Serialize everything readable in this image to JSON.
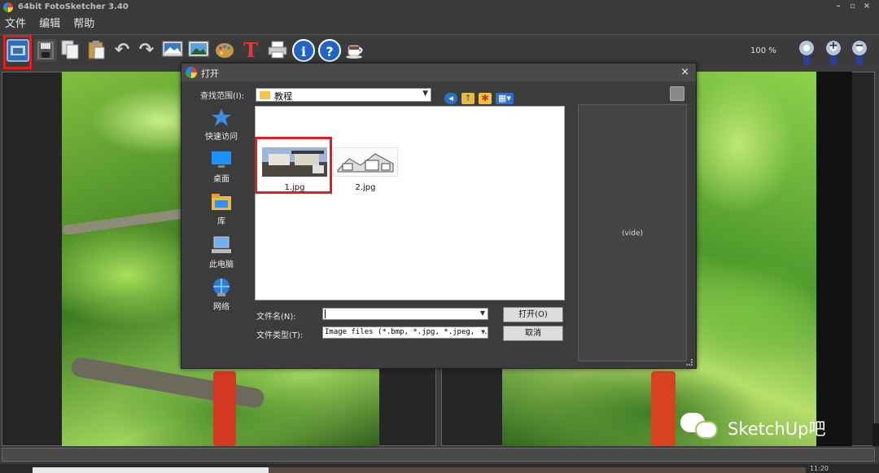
{
  "window": {
    "title": "64bit FotoSketcher 3.40",
    "controls": [
      "–",
      "▫",
      "×"
    ]
  },
  "menu": [
    "文件",
    "编辑",
    "帮助"
  ],
  "toolbar": {
    "zoom_level": "100 %",
    "icons": [
      "open-image-icon",
      "save-icon",
      "copy-icon",
      "paste-icon",
      "undo-icon",
      "redo-icon",
      "image-settings-icon",
      "landscape-icon",
      "palette-icon",
      "text-tool-icon",
      "print-icon",
      "info-icon",
      "help-icon",
      "coffee-icon"
    ],
    "zoom_buttons": [
      "zoom-fit-icon",
      "zoom-in-icon",
      "zoom-out-icon"
    ]
  },
  "dialog": {
    "title": "打开",
    "close": "×",
    "look_in_label": "查找范围(I):",
    "look_in_value": "教程",
    "places": [
      {
        "label": "快速访问",
        "icon": "star-icon"
      },
      {
        "label": "桌面",
        "icon": "desktop-icon"
      },
      {
        "label": "库",
        "icon": "library-icon"
      },
      {
        "label": "此电脑",
        "icon": "computer-icon"
      },
      {
        "label": "网络",
        "icon": "network-icon"
      }
    ],
    "files": [
      {
        "name": "1.jpg"
      },
      {
        "name": "2.jpg"
      }
    ],
    "preview_text": "(vide)",
    "filename_label": "文件名(N):",
    "filename_value": "",
    "filetype_label": "文件类型(T):",
    "filetype_value": "Image files (*.bmp, *.jpg, *.jpeg, *.",
    "open_button": "打开(O)",
    "cancel_button": "取消"
  },
  "watermark": "SketchUp吧",
  "taskbar_clock": "11:20"
}
